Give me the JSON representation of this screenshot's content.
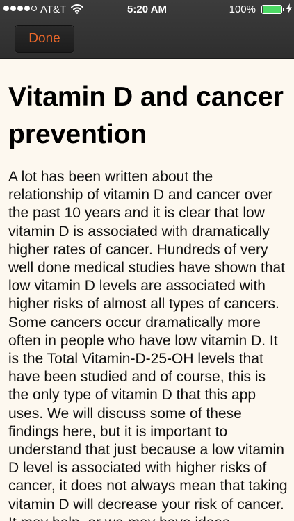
{
  "status_bar": {
    "carrier": "AT&T",
    "time": "5:20 AM",
    "battery_percent": "100%",
    "battery_level": 1.0,
    "signal_bars": 4,
    "signal_max": 5,
    "icons": [
      "signal-icon",
      "wifi-icon",
      "battery-icon",
      "charging-bolt-icon"
    ]
  },
  "nav": {
    "done_label": "Done",
    "done_color": "#e8672a"
  },
  "article": {
    "title": "Vitamin D and cancer prevention",
    "body": "A lot has been written about the relationship of vitamin D and cancer over the past 10 years and it is clear that low vitamin D is associated with dramatically higher rates of cancer. Hundreds of very well done medical studies have shown that low vitamin D levels are associated with higher risks of almost all types of cancers. Some cancers occur dramatically more often in people who have low vitamin D. It is the Total Vitamin-D-25-OH levels that have been studied and of course, this is the only type of vitamin D that this app uses. We will discuss some of these findings here, but it is important to understand that just because a low vitamin D level is associated with higher risks of cancer, it does not always mean that taking vitamin D will decrease your risk of cancer. It may help, or we may have ideas"
  },
  "colors": {
    "bar_background": "#333333",
    "page_background": "#fdf8ef",
    "battery_fill": "#4cd964"
  }
}
